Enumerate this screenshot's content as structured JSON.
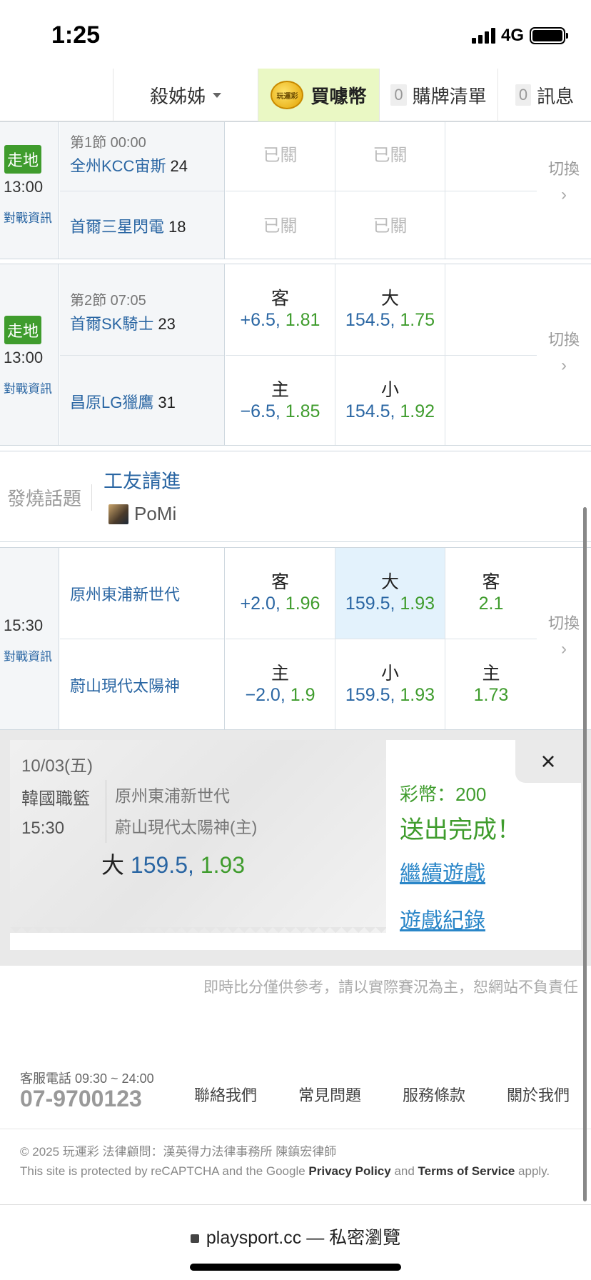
{
  "status": {
    "time": "1:25",
    "network": "4G"
  },
  "topnav": {
    "user": "殺姊姊",
    "buy": "買噱幣",
    "coin_text": "玩運彩",
    "cart_count": "0",
    "cart": "購牌清單",
    "msg_count": "0",
    "msg": "訊息"
  },
  "games": [
    {
      "badge": "走地",
      "time": "13:00",
      "info": "對戰資訊",
      "period": "第1節 00:00",
      "away": {
        "name": "全州KCC宙斯",
        "score": "24"
      },
      "home": {
        "name": "首爾三星閃電",
        "score": "18"
      },
      "closed": "已關",
      "switch": "切換"
    },
    {
      "badge": "走地",
      "time": "13:00",
      "info": "對戰資訊",
      "period": "第2節 07:05",
      "away": {
        "name": "首爾SK騎士",
        "score": "23"
      },
      "home": {
        "name": "昌原LG獵鷹",
        "score": "31"
      },
      "spread": {
        "away_label": "客",
        "away_line": "+6.5,",
        "away_odds": "1.81",
        "home_label": "主",
        "home_line": "−6.5,",
        "home_odds": "1.85"
      },
      "total": {
        "over_label": "大",
        "over_line": "154.5,",
        "over_odds": "1.75",
        "under_label": "小",
        "under_line": "154.5,",
        "under_odds": "1.92"
      },
      "switch": "切換"
    },
    {
      "time": "15:30",
      "info": "對戰資訊",
      "away": {
        "name": "原州東浦新世代"
      },
      "home": {
        "name": "蔚山現代太陽神"
      },
      "spread": {
        "away_label": "客",
        "away_line": "+2.0,",
        "away_odds": "1.96",
        "home_label": "主",
        "home_line": "−2.0,",
        "home_odds": "1.9"
      },
      "total": {
        "over_label": "大",
        "over_line": "159.5,",
        "over_odds": "1.93",
        "under_label": "小",
        "under_line": "159.5,",
        "under_odds": "1.93"
      },
      "moneyline": {
        "away_label": "客",
        "away_odds": "2.1",
        "home_label": "主",
        "home_odds": "1.73"
      },
      "switch": "切換"
    }
  ],
  "hot_topic": {
    "label": "發燒話題",
    "title": "工友請進",
    "user": "PoMi"
  },
  "bet_popup": {
    "date": "10/03(五)",
    "league": "韓國職籃",
    "time": "15:30",
    "team1": "原州東浦新世代",
    "team2": "蔚山現代太陽神(主)",
    "pick_label": "大",
    "pick_line": "159.5,",
    "pick_odds": "1.93",
    "close": "×",
    "coins": "彩幣：200",
    "done": "送出完成！",
    "continue": "繼續遊戲",
    "history": "遊戲紀錄"
  },
  "disclaimer": "即時比分僅供參考，請以實際賽況為主，恕網站不負責任",
  "footer": {
    "phone_label": "客服電話 09:30 ~ 24:00",
    "phone": "07-9700123",
    "links": [
      "聯絡我們",
      "常見問題",
      "服務條款",
      "關於我們"
    ],
    "copyright": "© 2025 玩運彩 法律顧問：漢英得力法律事務所 陳鎮宏律師",
    "recaptcha_pre": "This site is protected by reCAPTCHA and the Google ",
    "privacy": "Privacy Policy",
    "and": " and ",
    "terms": "Terms of Service",
    "apply": " apply."
  },
  "urlbar": {
    "url": "playsport.cc — 私密瀏覽"
  }
}
